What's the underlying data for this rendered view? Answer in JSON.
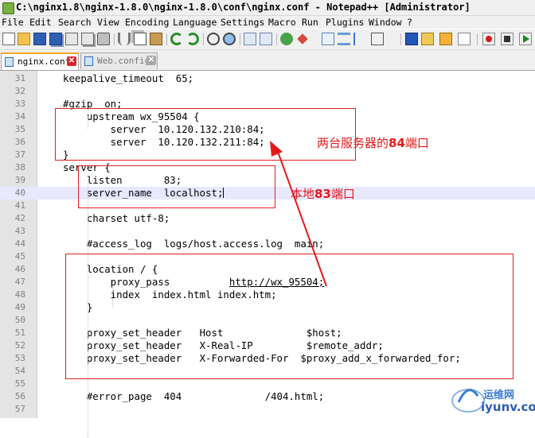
{
  "window": {
    "title": "C:\\nginx1.8\\nginx-1.8.0\\nginx-1.8.0\\conf\\nginx.conf - Notepad++ [Administrator]"
  },
  "menu": [
    "File",
    "Edit",
    "Search",
    "View",
    "Encoding",
    "Language",
    "Settings",
    "Macro",
    "Run",
    "Plugins",
    "Window",
    "?"
  ],
  "toolbar": {
    "icons": [
      "new-file-icon",
      "open-file-icon",
      "save-icon",
      "save-all-icon",
      "close-icon",
      "close-all-icon",
      "print-icon",
      "cut-icon",
      "copy-icon",
      "paste-icon",
      "undo-icon",
      "redo-icon",
      "find-icon",
      "replace-icon",
      "zoom-in-icon",
      "zoom-out-icon",
      "sync-vertical-icon",
      "sync-horizontal-icon",
      "word-wrap-icon",
      "show-all-chars-icon",
      "indent-guide-icon",
      "doc-map-icon",
      "function-list-icon",
      "folder-workspace-icon",
      "monitoring-icon",
      "record-macro-icon",
      "stop-record-icon",
      "play-macro-icon"
    ]
  },
  "tabs": [
    {
      "label": "nginx.conf",
      "active": true
    },
    {
      "label": "Web.config",
      "active": false
    }
  ],
  "editor": {
    "current_line": 40,
    "lines": [
      {
        "num": "31",
        "text": "keepalive_timeout  65;"
      },
      {
        "num": "32",
        "text": ""
      },
      {
        "num": "33",
        "text": "#gzip  on;"
      },
      {
        "num": "34",
        "text": "    upstream wx_95504 {"
      },
      {
        "num": "35",
        "text": "        server  10.120.132.210:84;"
      },
      {
        "num": "36",
        "text": "        server  10.120.132.211:84;"
      },
      {
        "num": "37",
        "text": "}"
      },
      {
        "num": "38",
        "text": "server {"
      },
      {
        "num": "39",
        "text": "    listen       83;"
      },
      {
        "num": "40",
        "text": "    server_name  localhost;"
      },
      {
        "num": "41",
        "text": ""
      },
      {
        "num": "42",
        "text": "    charset utf-8;"
      },
      {
        "num": "43",
        "text": ""
      },
      {
        "num": "44",
        "text": "    #access_log  logs/host.access.log  main;"
      },
      {
        "num": "45",
        "text": ""
      },
      {
        "num": "46",
        "text": "    location / {"
      },
      {
        "num": "47",
        "text": "        proxy_pass          ",
        "url": "http://wx_95504;"
      },
      {
        "num": "48",
        "text": "        index  index.html index.htm;"
      },
      {
        "num": "49",
        "text": "    }"
      },
      {
        "num": "50",
        "text": ""
      },
      {
        "num": "51",
        "text": "    proxy_set_header   Host              $host;"
      },
      {
        "num": "52",
        "text": "    proxy_set_header   X-Real-IP         $remote_addr;"
      },
      {
        "num": "53",
        "text": "    proxy_set_header   X-Forwarded-For  $proxy_add_x_forwarded_for;"
      },
      {
        "num": "54",
        "text": ""
      },
      {
        "num": "55",
        "text": ""
      },
      {
        "num": "56",
        "text": "    #error_page  404              /404.html;"
      },
      {
        "num": "57",
        "text": ""
      }
    ]
  },
  "annotations": {
    "upstream_note": {
      "prefix": "两台服务器的",
      "number": "84",
      "suffix": "端口"
    },
    "local_note": {
      "prefix": "本地",
      "number": "83",
      "suffix": "端口"
    },
    "color": "#e81818"
  },
  "watermark": {
    "name": "运维网",
    "domain": "iyunv.com"
  }
}
